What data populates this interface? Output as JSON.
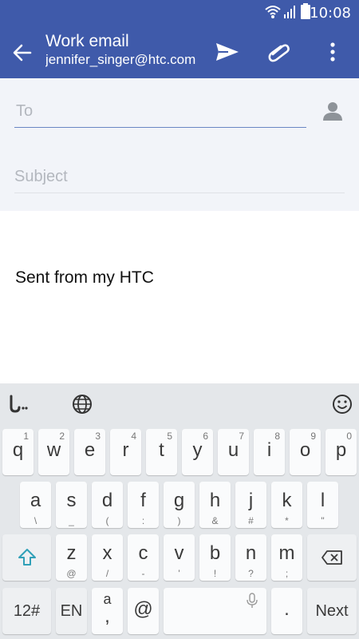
{
  "status": {
    "time": "10:08"
  },
  "header": {
    "title": "Work email",
    "subtitle": "jennifer_singer@htc.com",
    "icons": [
      "back-arrow-icon",
      "send-icon",
      "attach-icon",
      "more-vert-icon"
    ]
  },
  "compose": {
    "to_placeholder": "To",
    "to_value": "",
    "subject_placeholder": "Subject",
    "subject_value": "",
    "signature": "Sent from my HTC"
  },
  "keyboard": {
    "top_icons": [
      "swype-icon",
      "globe-icon",
      "smiley-icon"
    ],
    "row1": [
      {
        "key": "q",
        "alt": "1"
      },
      {
        "key": "w",
        "alt": "2"
      },
      {
        "key": "e",
        "alt": "3"
      },
      {
        "key": "r",
        "alt": "4"
      },
      {
        "key": "t",
        "alt": "5"
      },
      {
        "key": "y",
        "alt": "6"
      },
      {
        "key": "u",
        "alt": "7"
      },
      {
        "key": "i",
        "alt": "8"
      },
      {
        "key": "o",
        "alt": "9"
      },
      {
        "key": "p",
        "alt": "0"
      }
    ],
    "row2": [
      {
        "key": "a",
        "alt": "\\"
      },
      {
        "key": "s",
        "alt": "_"
      },
      {
        "key": "d",
        "alt": "("
      },
      {
        "key": "f",
        "alt": ":"
      },
      {
        "key": "g",
        "alt": ")"
      },
      {
        "key": "h",
        "alt": "&"
      },
      {
        "key": "j",
        "alt": "#"
      },
      {
        "key": "k",
        "alt": "*"
      },
      {
        "key": "l",
        "alt": "\""
      }
    ],
    "row3": [
      {
        "key": "z",
        "alt": "@"
      },
      {
        "key": "x",
        "alt": "/"
      },
      {
        "key": "c",
        "alt": "-"
      },
      {
        "key": "v",
        "alt": "'"
      },
      {
        "key": "b",
        "alt": "!"
      },
      {
        "key": "n",
        "alt": "?"
      },
      {
        "key": "m",
        "alt": ";"
      }
    ],
    "row4": {
      "numbers": "12#",
      "language": "EN",
      "comma_key": "a",
      "comma_alt": ",",
      "at": "@",
      "period": ".",
      "next": "Next"
    }
  },
  "colors": {
    "accent": "#3f5aaa",
    "fields_bg": "#f2f4f9",
    "keyboard_bg": "#e4e7ea",
    "shift": "#30a0b8"
  }
}
